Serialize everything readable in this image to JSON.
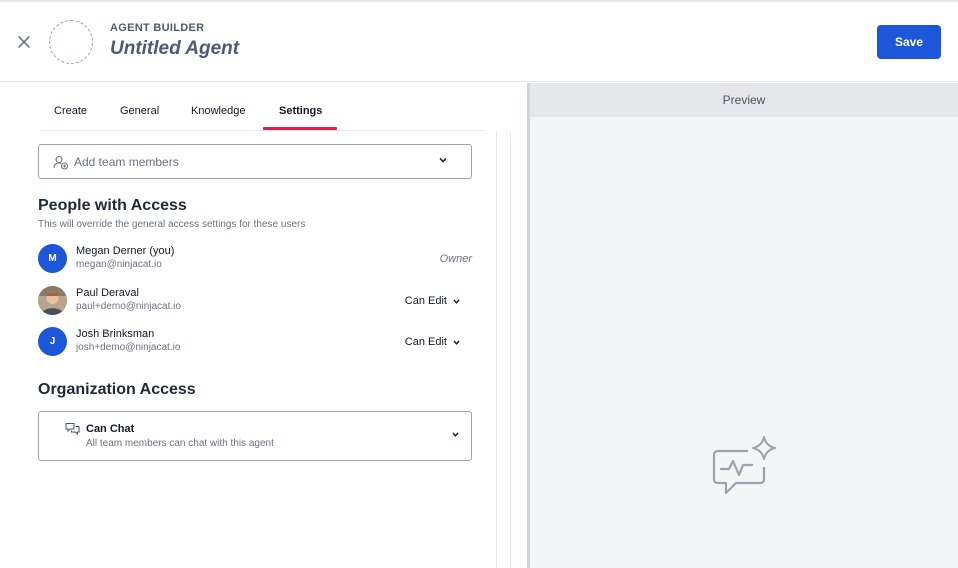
{
  "header": {
    "section_label": "AGENT BUILDER",
    "agent_name": "Untitled Agent",
    "save_label": "Save"
  },
  "tabs": [
    {
      "label": "Create",
      "active": false
    },
    {
      "label": "General",
      "active": false
    },
    {
      "label": "Knowledge",
      "active": false
    },
    {
      "label": "Settings",
      "active": true
    }
  ],
  "add_members": {
    "placeholder": "Add team members"
  },
  "people_access": {
    "title": "People with Access",
    "subtitle": "This will override the general access settings for these users",
    "people": [
      {
        "initial": "M",
        "name": "Megan Derner (you)",
        "email": "megan@ninjacat.io",
        "role": "Owner",
        "editable": false
      },
      {
        "initial": "",
        "name": "Paul Deraval",
        "email": "paul+demo@ninjacat.io",
        "role": "Can Edit",
        "editable": true
      },
      {
        "initial": "J",
        "name": "Josh Brinksman",
        "email": "josh+demo@ninjacat.io",
        "role": "Can Edit",
        "editable": true
      }
    ]
  },
  "org_access": {
    "title": "Organization Access",
    "permission": "Can Chat",
    "description": "All team members can chat with this agent"
  },
  "preview": {
    "label": "Preview"
  },
  "colors": {
    "primary": "#1d56d8",
    "active_tab_underline": "#e11d48",
    "title_slate": "#4b5b74"
  }
}
